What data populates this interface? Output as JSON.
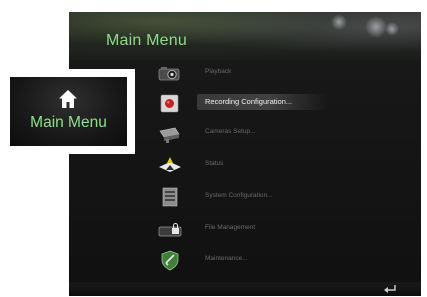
{
  "main_menu": {
    "title": "Main Menu",
    "items": [
      {
        "label": "Playback",
        "icon": "playback-camera-icon",
        "selected": false
      },
      {
        "label": "Recording Configuration...",
        "icon": "recording-icon",
        "selected": true
      },
      {
        "label": "Cameras Setup...",
        "icon": "camera-setup-icon",
        "selected": false
      },
      {
        "label": "Status",
        "icon": "status-icon",
        "selected": false
      },
      {
        "label": "System Configuration...",
        "icon": "system-config-icon",
        "selected": false
      },
      {
        "label": "File Management",
        "icon": "file-management-icon",
        "selected": false
      },
      {
        "label": "Maintenance...",
        "icon": "maintenance-icon",
        "selected": false
      }
    ],
    "back_icon": "back-arrow-icon"
  },
  "zoom_callout": {
    "label": "Main Menu",
    "icon": "home-icon"
  },
  "colors": {
    "accent_green": "#8fd98a",
    "item_text": "#6a6a6a",
    "selected_text": "#f2f2f2"
  }
}
